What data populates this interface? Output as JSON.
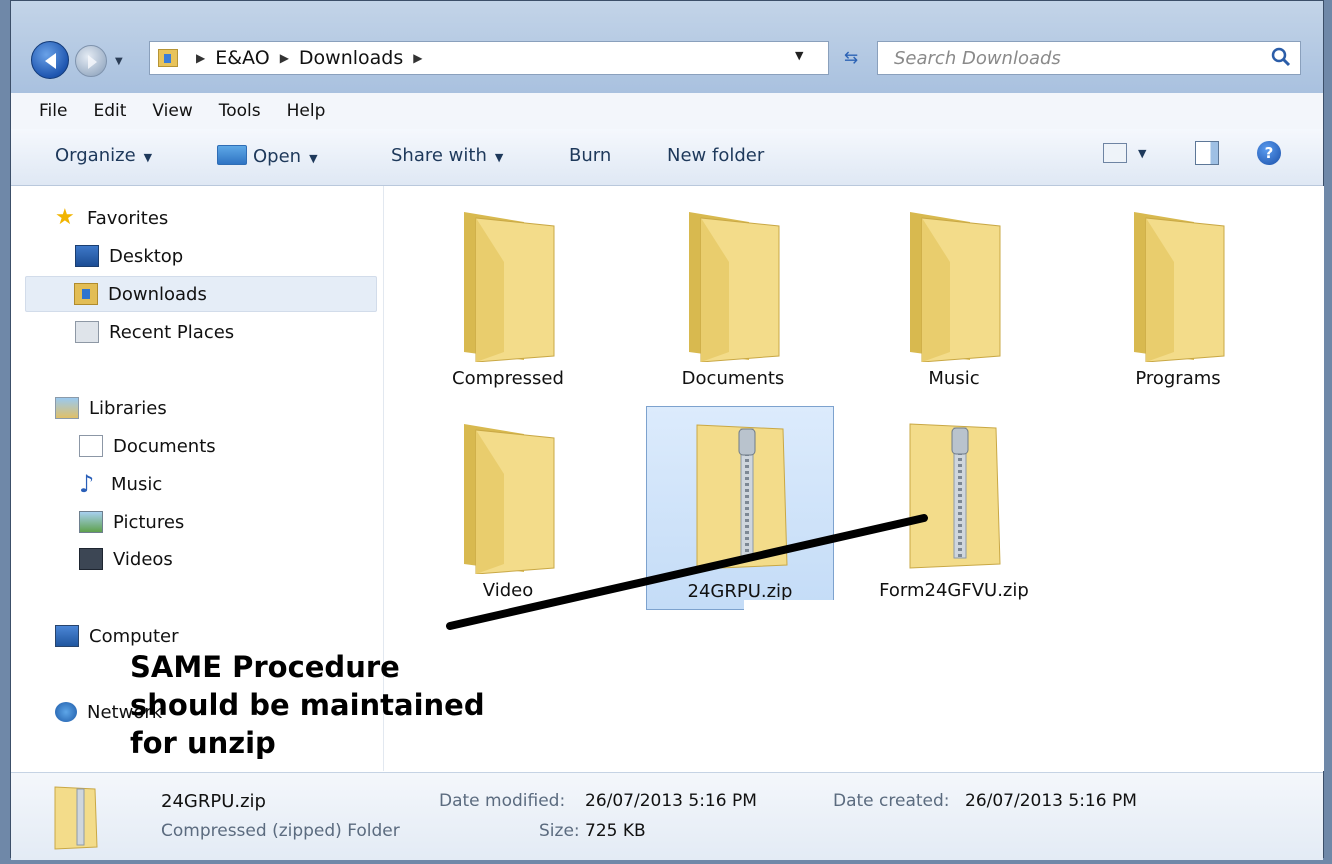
{
  "address_bar": {
    "breadcrumbs": [
      "E&AO",
      "Downloads"
    ],
    "search_placeholder": "Search Downloads"
  },
  "menu": [
    "File",
    "Edit",
    "View",
    "Tools",
    "Help"
  ],
  "toolbar": {
    "organize": "Organize",
    "open": "Open",
    "share_with": "Share with",
    "burn": "Burn",
    "new_folder": "New folder"
  },
  "nav": {
    "favorites": "Favorites",
    "desktop": "Desktop",
    "downloads": "Downloads",
    "recent_places": "Recent Places",
    "libraries": "Libraries",
    "documents": "Documents",
    "music": "Music",
    "pictures": "Pictures",
    "videos": "Videos",
    "computer": "Computer",
    "network": "Network"
  },
  "files": [
    {
      "name": "Compressed",
      "type": "folder"
    },
    {
      "name": "Documents",
      "type": "folder"
    },
    {
      "name": "Music",
      "type": "folder"
    },
    {
      "name": "Programs",
      "type": "folder"
    },
    {
      "name": "Video",
      "type": "folder"
    },
    {
      "name": "24GRPU.zip",
      "type": "zip",
      "selected": true
    },
    {
      "name": "Form24GFVU.zip",
      "type": "zip"
    }
  ],
  "annotation": [
    "SAME Procedure",
    "should be maintained",
    "for unzip"
  ],
  "details": {
    "name": "24GRPU.zip",
    "type": "Compressed (zipped) Folder",
    "date_modified_label": "Date modified:",
    "date_modified": "26/07/2013 5:16 PM",
    "size_label": "Size:",
    "size": "725 KB",
    "date_created_label": "Date created:",
    "date_created": "26/07/2013 5:16 PM"
  }
}
